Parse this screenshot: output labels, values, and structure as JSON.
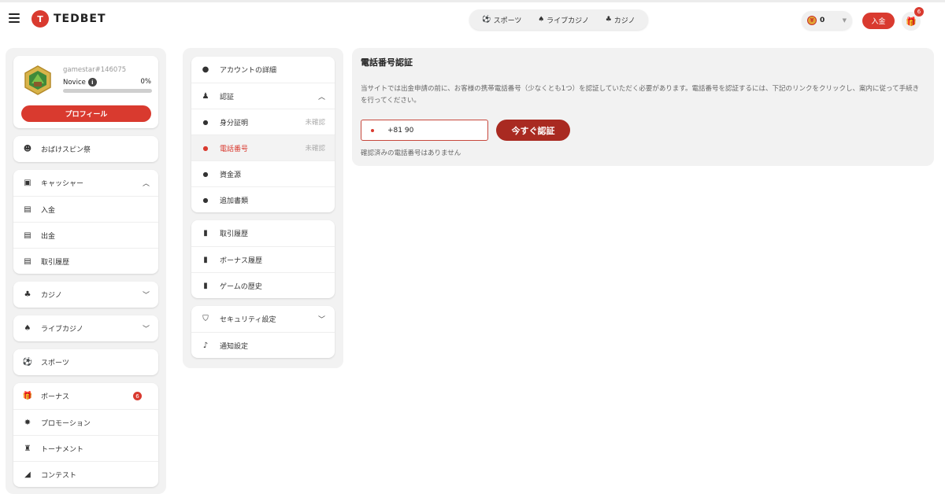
{
  "header": {
    "logo_text": "TEDBET",
    "logo_mark": "T",
    "nav": [
      {
        "label": "スポーツ",
        "icon": "soccer-ball-icon"
      },
      {
        "label": "ライブカジノ",
        "icon": "dealer-icon"
      },
      {
        "label": "カジノ",
        "icon": "slot-icon"
      }
    ],
    "balance": "0",
    "deposit_label": "入金",
    "gift_badge": "6"
  },
  "profile": {
    "username": "gamestar#146075",
    "level": "Novice",
    "progress_pct": "0%",
    "progress": 0,
    "button": "プロフィール"
  },
  "sidebar": {
    "spin": "おばけスピン祭",
    "cashier": {
      "label": "キャッシャー",
      "items": [
        "入金",
        "出金",
        "取引履歴"
      ]
    },
    "casino": "カジノ",
    "live_casino": "ライブカジノ",
    "sports": "スポーツ",
    "promo": {
      "bonus": "ボーナス",
      "bonus_badge": "6",
      "promotion": "プロモーション",
      "tournament": "トーナメント",
      "contest": "コンテスト"
    }
  },
  "account_menu": {
    "account_details": "アカウントの詳細",
    "verification": "認証",
    "verification_items": [
      {
        "label": "身分証明",
        "status": "未確認"
      },
      {
        "label": "電話番号",
        "status": "未確認"
      },
      {
        "label": "資金源",
        "status": ""
      },
      {
        "label": "追加書類",
        "status": ""
      }
    ],
    "history": [
      "取引履歴",
      "ボーナス履歴",
      "ゲームの歴史"
    ],
    "security": "セキュリティ設定",
    "notifications": "通知設定"
  },
  "phone_verification": {
    "title": "電話番号認証",
    "description": "当サイトでは出金申請の前に、お客様の携帯電話番号（少なくとも1つ）を認証していただく必要があります。電話番号を認証するには、下記のリンクをクリックし、案内に従って手続きを行ってください。",
    "phone_value": "+81 90",
    "verify_button": "今すぐ認証",
    "no_verified": "確認済みの電話番号はありません"
  },
  "colors": {
    "accent": "#d93a2f",
    "accent_dark": "#a92a21",
    "panel_bg": "#f2f2f2"
  }
}
